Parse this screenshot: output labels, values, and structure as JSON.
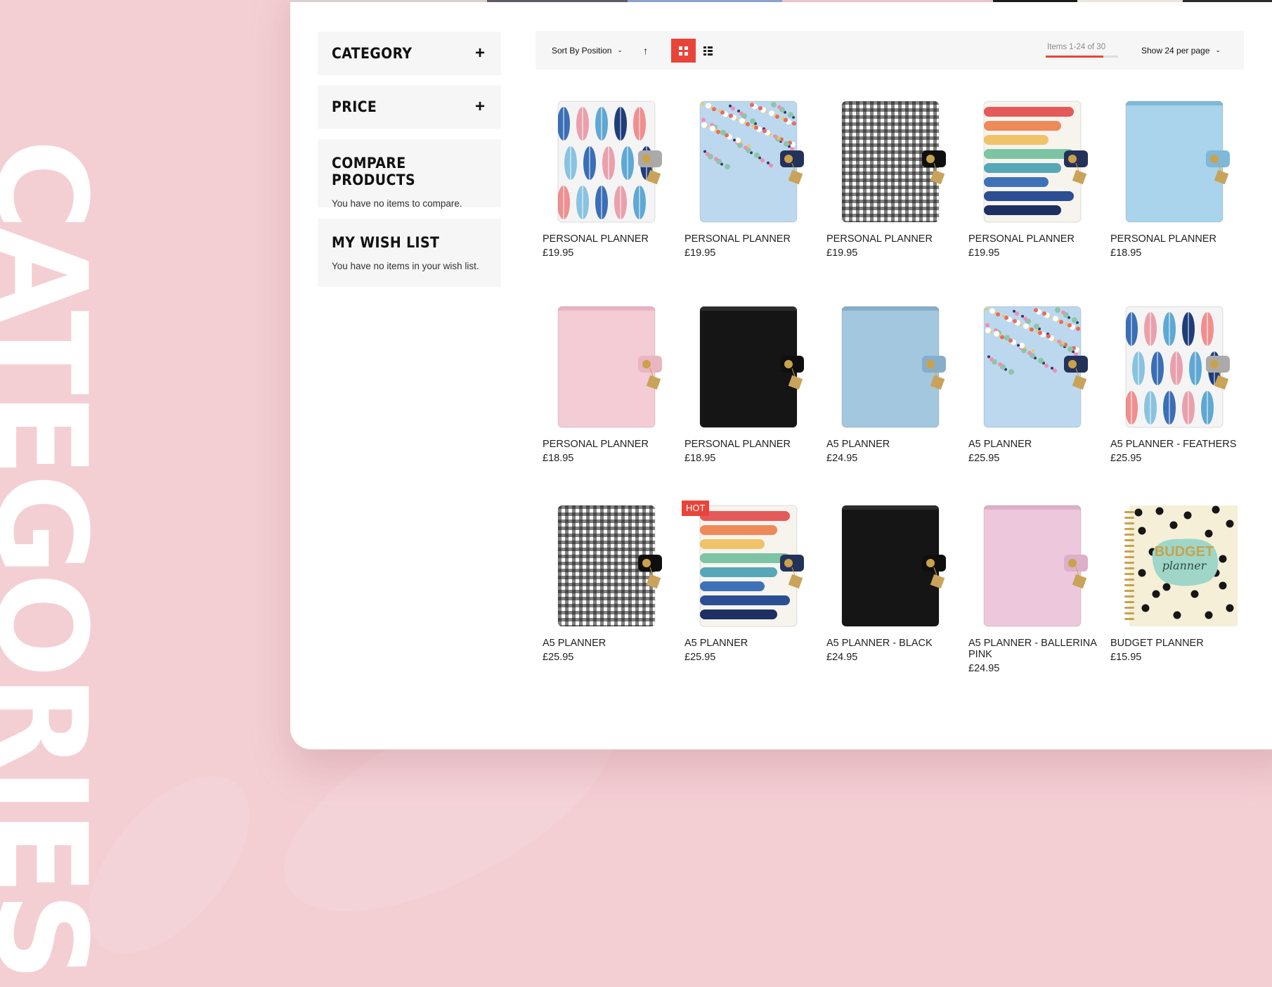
{
  "banner": {
    "word": "CATEGORIES"
  },
  "sidebar": {
    "category": {
      "title": "CATEGORY"
    },
    "price": {
      "title": "PRICE"
    },
    "compare": {
      "title": "COMPARE PRODUCTS",
      "text": "You have no items to compare."
    },
    "wishlist": {
      "title": "MY WISH LIST",
      "text": "You have no items in your wish list."
    },
    "expand_symbol": "+"
  },
  "toolbar": {
    "sort_label": "Sort By Position",
    "sort_chevron": "⌄",
    "direction_arrow": "↑",
    "items_count": "Items 1-24 of 30",
    "items_progress": 0.8,
    "per_page_label": "Show 24 per page",
    "per_page_chevron": "⌄"
  },
  "products": [
    {
      "name": "PERSONAL PLANNER",
      "price": "£19.95",
      "design": "feathers"
    },
    {
      "name": "PERSONAL PLANNER",
      "price": "£19.95",
      "design": "floral"
    },
    {
      "name": "PERSONAL PLANNER",
      "price": "£19.95",
      "design": "gingham"
    },
    {
      "name": "PERSONAL PLANNER",
      "price": "£19.95",
      "design": "rainbow"
    },
    {
      "name": "PERSONAL PLANNER",
      "price": "£18.95",
      "design": "light-blue"
    },
    {
      "name": "PERSONAL PLANNER",
      "price": "£18.95",
      "design": "pink"
    },
    {
      "name": "PERSONAL PLANNER",
      "price": "£18.95",
      "design": "black"
    },
    {
      "name": "A5 PLANNER",
      "price": "£24.95",
      "design": "blue"
    },
    {
      "name": "A5 PLANNER",
      "price": "£25.95",
      "design": "floral"
    },
    {
      "name": "A5 PLANNER - FEATHERS",
      "price": "£25.95",
      "design": "feathers"
    },
    {
      "name": "A5 PLANNER",
      "price": "£25.95",
      "design": "gingham"
    },
    {
      "name": "A5 PLANNER",
      "price": "£25.95",
      "design": "rainbow",
      "badge": "HOT"
    },
    {
      "name": "A5 PLANNER - BLACK",
      "price": "£24.95",
      "design": "black"
    },
    {
      "name": "A5 PLANNER - BALLERINA PINK",
      "price": "£24.95",
      "design": "lavender"
    },
    {
      "name": "BUDGET PLANNER",
      "price": "£15.95",
      "design": "budget",
      "cover_text": [
        "BUDGET",
        "planner"
      ]
    }
  ],
  "colors": {
    "accent": "#e8443a",
    "page_background": "#f3cfd4",
    "panel": "#ffffff",
    "sidebar_block": "#f6f6f6"
  }
}
